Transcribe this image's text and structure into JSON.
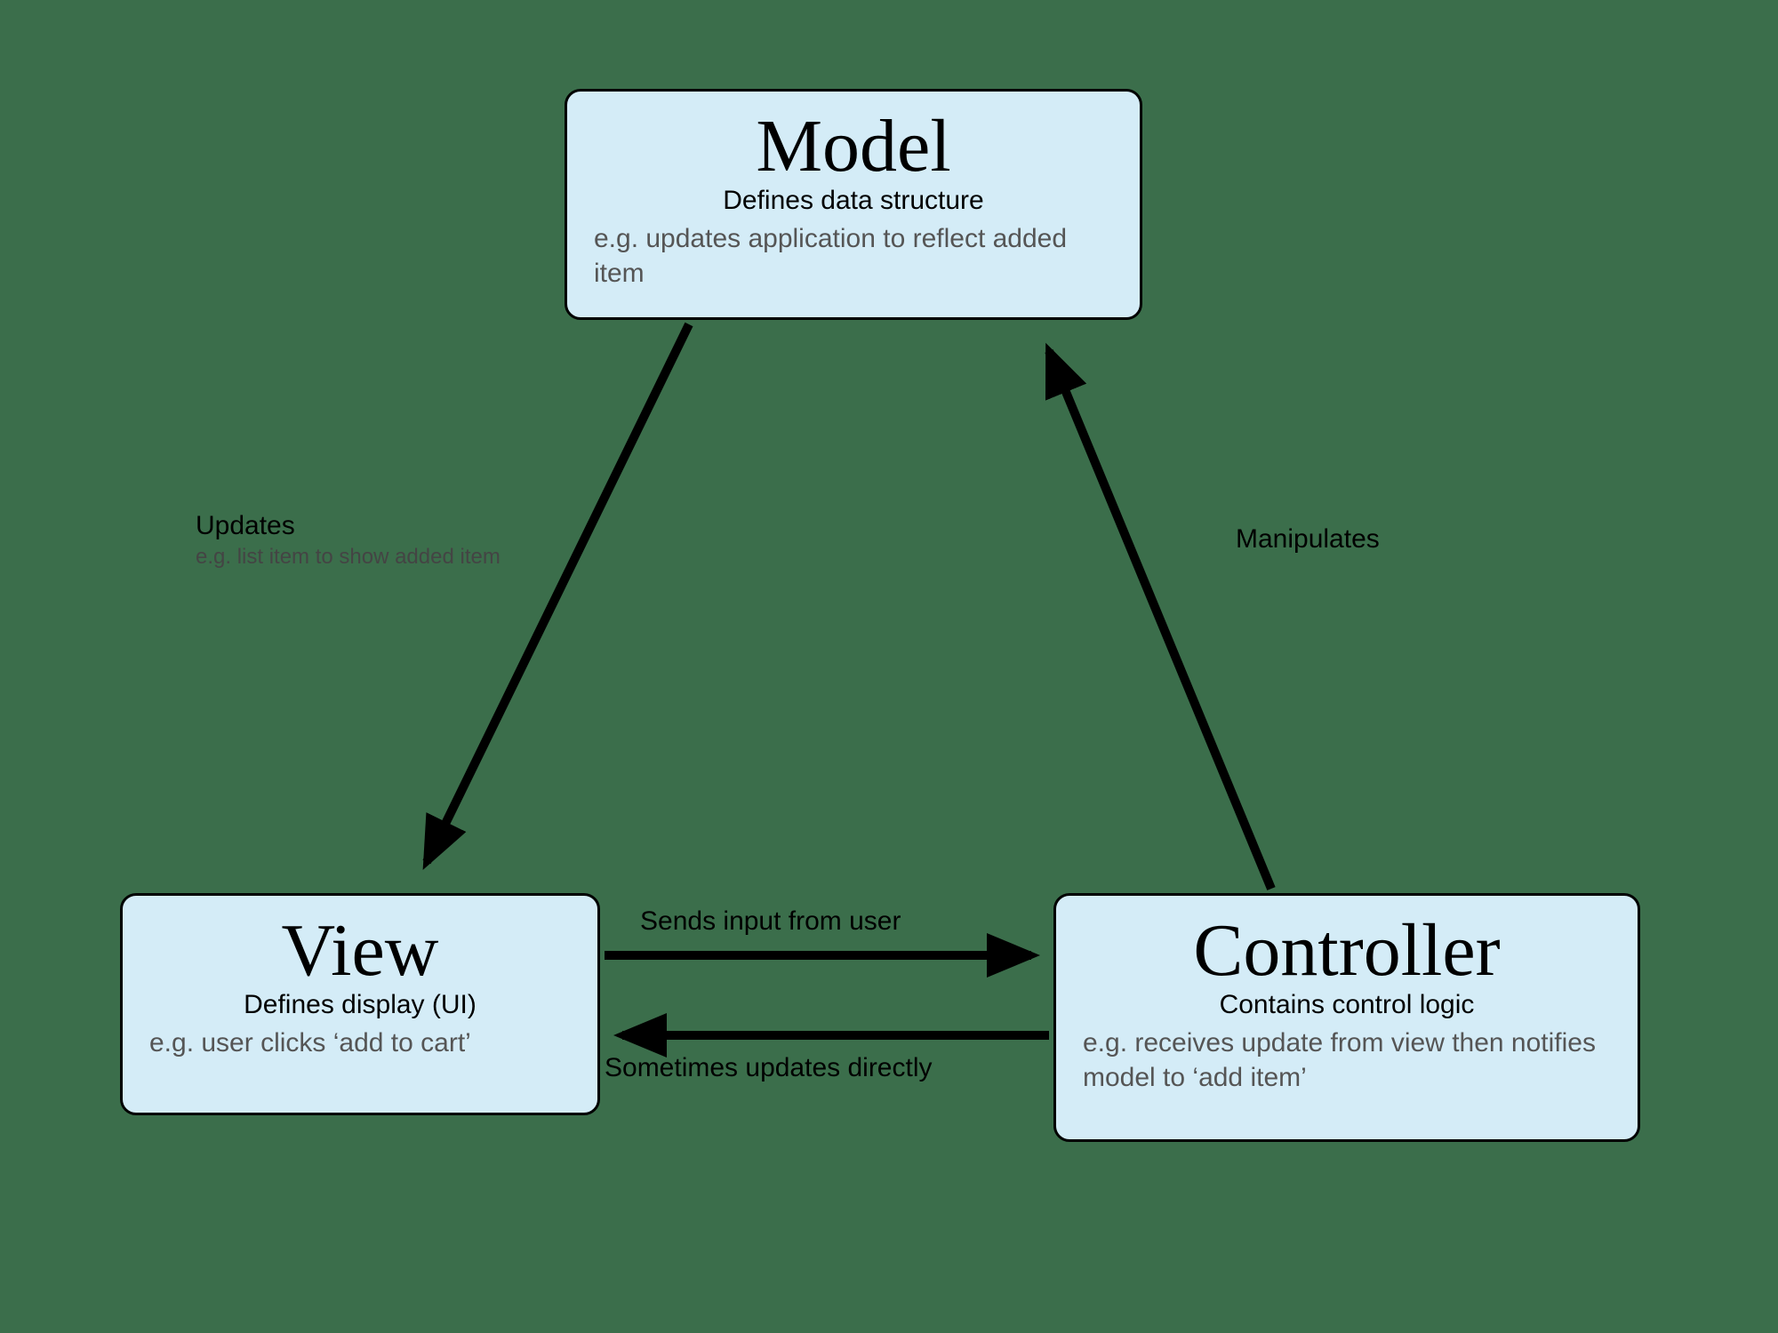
{
  "nodes": {
    "model": {
      "title": "Model",
      "sub": "Defines data structure",
      "ex": "e.g. updates application to reflect added item"
    },
    "view": {
      "title": "View",
      "sub": "Defines display (UI)",
      "ex": "e.g. user clicks ‘add to cart’"
    },
    "controller": {
      "title": "Controller",
      "sub": "Contains control logic",
      "ex": "e.g. receives update from view then notifies model to ‘add item’"
    }
  },
  "edges": {
    "model_to_view": {
      "label": "Updates",
      "sub": "e.g. list item to show added item"
    },
    "controller_to_model": {
      "label": "Manipulates"
    },
    "view_to_controller": {
      "label": "Sends input from user"
    },
    "controller_to_view": {
      "label": "Sometimes updates directly"
    }
  }
}
